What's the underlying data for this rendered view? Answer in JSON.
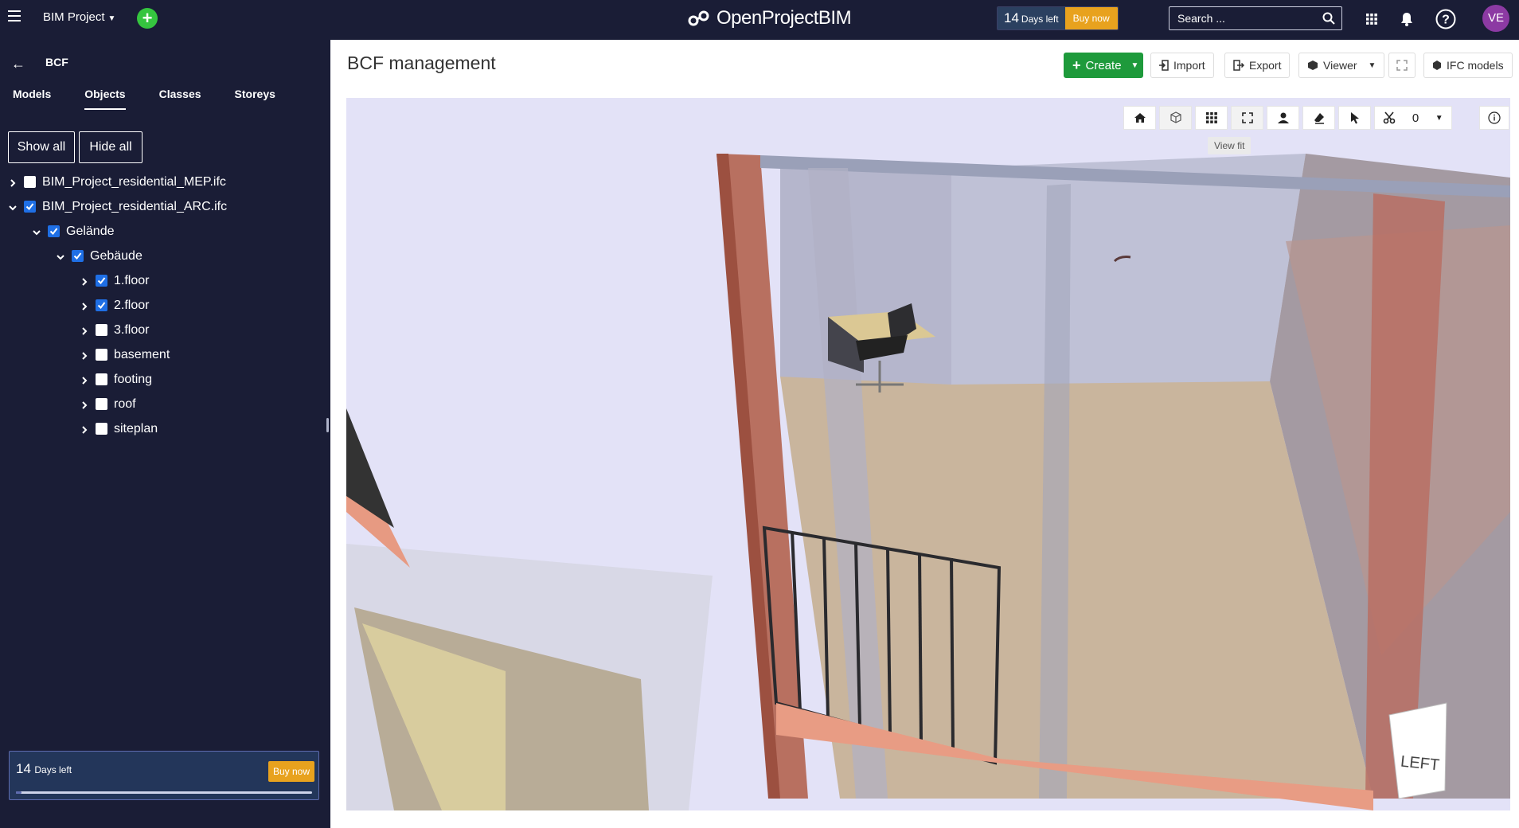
{
  "header": {
    "project_name": "BIM Project",
    "logo_text": "OpenProjectBIM",
    "trial_days": "14",
    "trial_days_label": "Days left",
    "buy_now": "Buy now",
    "search_placeholder": "Search ...",
    "avatar_initials": "VE"
  },
  "sidebar": {
    "title": "BCF",
    "tabs": [
      "Models",
      "Objects",
      "Classes",
      "Storeys"
    ],
    "active_tab": "Objects",
    "show_all": "Show all",
    "hide_all": "Hide all",
    "tree": [
      {
        "label": "BIM_Project_residential_MEP.ifc",
        "checked": false,
        "expanded": false
      },
      {
        "label": "BIM_Project_residential_ARC.ifc",
        "checked": true,
        "expanded": true
      },
      {
        "label": "Gelände",
        "checked": true,
        "expanded": true
      },
      {
        "label": "Gebäude",
        "checked": true,
        "expanded": true
      },
      {
        "label": "1.floor",
        "checked": true,
        "expanded": false
      },
      {
        "label": "2.floor",
        "checked": true,
        "expanded": false
      },
      {
        "label": "3.floor",
        "checked": false,
        "expanded": false
      },
      {
        "label": "basement",
        "checked": false,
        "expanded": false
      },
      {
        "label": "footing",
        "checked": false,
        "expanded": false
      },
      {
        "label": "roof",
        "checked": false,
        "expanded": false
      },
      {
        "label": "siteplan",
        "checked": false,
        "expanded": false
      }
    ],
    "trial_days": "14",
    "trial_days_label": "Days left",
    "buy_now": "Buy now",
    "trial_progress": 0.02
  },
  "main": {
    "title": "BCF management",
    "create_label": "Create",
    "import_label": "Import",
    "export_label": "Export",
    "viewer_label": "Viewer",
    "ifc_models_label": "IFC models"
  },
  "viewer": {
    "section_count": "0",
    "tooltip": "View fit",
    "navcube_label": "LEFT",
    "tools": [
      "home-icon",
      "perspective-cube-icon",
      "grid-icon",
      "fit-view-icon",
      "first-person-icon",
      "eraser-icon",
      "select-pointer-icon",
      "section-scissors-icon",
      "info-icon"
    ]
  },
  "colors": {
    "header_bg": "#1a1d36",
    "accent_green": "#1e9a3b",
    "buy_orange": "#e8a21e",
    "checkbox_blue": "#1f6fe5",
    "avatar_purple": "#8c3aa3"
  }
}
